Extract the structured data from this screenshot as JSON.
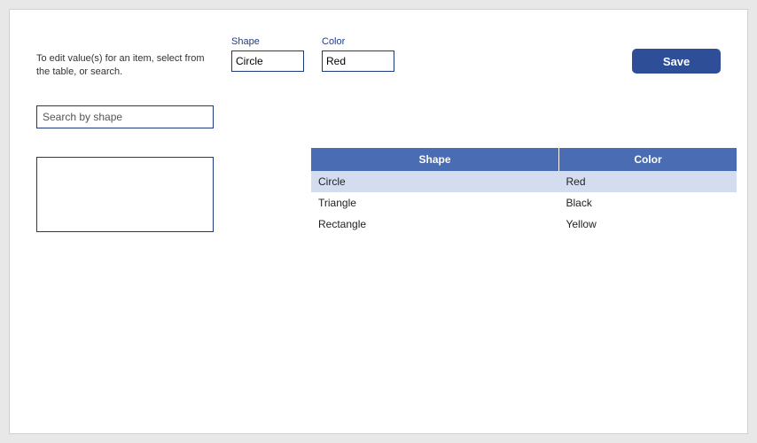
{
  "instructions": "To edit value(s) for an item, select from the table, or search.",
  "fields": {
    "shape": {
      "label": "Shape",
      "value": "Circle"
    },
    "color": {
      "label": "Color",
      "value": "Red"
    }
  },
  "save_label": "Save",
  "search": {
    "placeholder": "Search by shape",
    "value": ""
  },
  "table": {
    "headers": [
      "Shape",
      "Color"
    ],
    "rows": [
      {
        "shape": "Circle",
        "color": "Red",
        "selected": true
      },
      {
        "shape": "Triangle",
        "color": "Black",
        "selected": false
      },
      {
        "shape": "Rectangle",
        "color": "Yellow",
        "selected": false
      }
    ]
  },
  "colors": {
    "accent": "#2f4e98",
    "border": "#1a3a7a",
    "header_bg": "#4a6cb3",
    "row_selected": "#d4ddf0"
  }
}
